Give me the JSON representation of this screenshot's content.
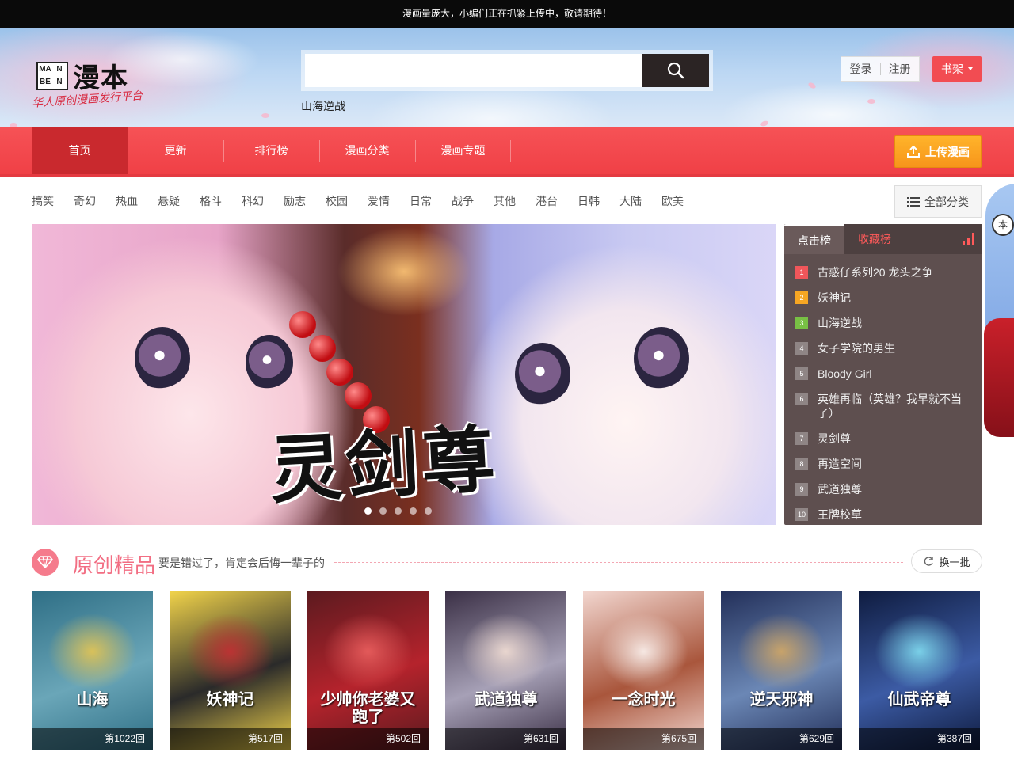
{
  "notice": "漫画量庞大，小编们正在抓紧上传中，敬请期待！",
  "logo": {
    "box_letters": [
      "MA",
      "N",
      "BE",
      "N"
    ],
    "name": "漫本",
    "slogan": "华人原创漫画发行平台"
  },
  "search": {
    "value": "",
    "placeholder": "",
    "hot_word": "山海逆战"
  },
  "auth": {
    "login": "登录",
    "register": "注册"
  },
  "shelf_label": "书架",
  "nav": {
    "items": [
      {
        "label": "首页"
      },
      {
        "label": "更新"
      },
      {
        "label": "排行榜"
      },
      {
        "label": "漫画分类"
      },
      {
        "label": "漫画专题"
      }
    ],
    "upload_label": "上传漫画"
  },
  "categories": [
    "搞笑",
    "奇幻",
    "热血",
    "悬疑",
    "格斗",
    "科幻",
    "励志",
    "校园",
    "爱情",
    "日常",
    "战争",
    "其他",
    "港台",
    "日韩",
    "大陆",
    "欧美"
  ],
  "all_categories_label": "全部分类",
  "banner": {
    "title_text": "灵剑尊",
    "slide_count": 5,
    "active_slide": 1
  },
  "ranking": {
    "tab_clicks": "点击榜",
    "tab_collect": "收藏榜",
    "items": [
      {
        "num": "1",
        "title": "古惑仔系列20 龙头之争"
      },
      {
        "num": "2",
        "title": "妖神记"
      },
      {
        "num": "3",
        "title": "山海逆战"
      },
      {
        "num": "4",
        "title": "女子学院的男生"
      },
      {
        "num": "5",
        "title": "Bloody Girl"
      },
      {
        "num": "6",
        "title": "英雄再临（英雄？我早就不当了）"
      },
      {
        "num": "7",
        "title": "灵剑尊"
      },
      {
        "num": "8",
        "title": "再造空间"
      },
      {
        "num": "9",
        "title": "武道独尊"
      },
      {
        "num": "10",
        "title": "王牌校草"
      }
    ]
  },
  "sidechar_tag": "本",
  "section": {
    "title": "原创精品",
    "subtitle": "要是错过了，肯定会后悔一辈子的",
    "refresh_label": "换一批"
  },
  "cards": [
    {
      "cover_text": "山海",
      "episode": "第1022回",
      "colors": [
        "#2f6f86",
        "#6aa6b8",
        "#d9c15a"
      ]
    },
    {
      "cover_text": "妖神记",
      "episode": "第517回",
      "colors": [
        "#f1d34a",
        "#2a2a2a",
        "#b33"
      ]
    },
    {
      "cover_text": "少帅你老婆又跑了",
      "episode": "第502回",
      "colors": [
        "#5c1a1f",
        "#b5232c",
        "#e35a5a"
      ]
    },
    {
      "cover_text": "武道独尊",
      "episode": "第631回",
      "colors": [
        "#3b3046",
        "#a6a0b6",
        "#e9d6cf"
      ]
    },
    {
      "cover_text": "一念时光",
      "episode": "第675回",
      "colors": [
        "#f2d6cf",
        "#a9563c",
        "#f6e8e3"
      ]
    },
    {
      "cover_text": "逆天邪神",
      "episode": "第629回",
      "colors": [
        "#23305a",
        "#6b87b5",
        "#c8a36a"
      ]
    },
    {
      "cover_text": "仙武帝尊",
      "episode": "第387回",
      "colors": [
        "#0f1c40",
        "#3c5ba4",
        "#7ad0e8"
      ]
    }
  ]
}
